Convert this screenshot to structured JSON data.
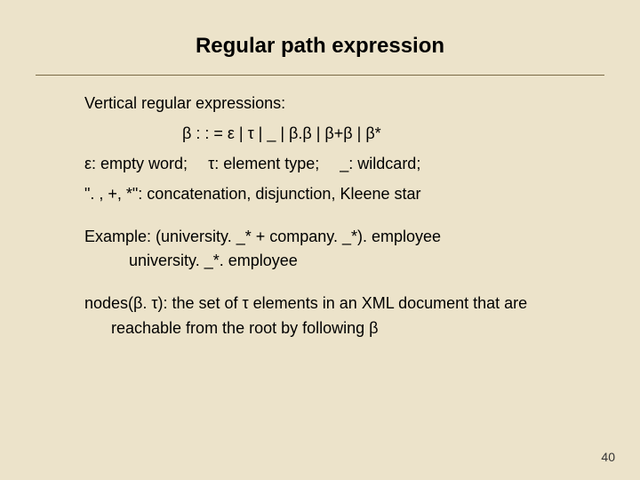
{
  "title": "Regular path expression",
  "line1": "Vertical regular expressions:",
  "grammar": "β  : : =  ε   |  τ  |   _   |  β.β   |   β+β   |  β*",
  "defs_eps": "ε: empty word;",
  "defs_tau": "τ:  element type;",
  "defs_us": "_: wildcard;",
  "defs2": "\". , +, *\":  concatenation, disjunction, Kleene star",
  "example_label": "Example: (university. _* +  company. _*). employee",
  "example_sub": "university. _*. employee",
  "nodes1": "nodes(β. τ): the set of τ elements in an XML document that are",
  "nodes2": "reachable from the root by following β",
  "pagenum": "40"
}
